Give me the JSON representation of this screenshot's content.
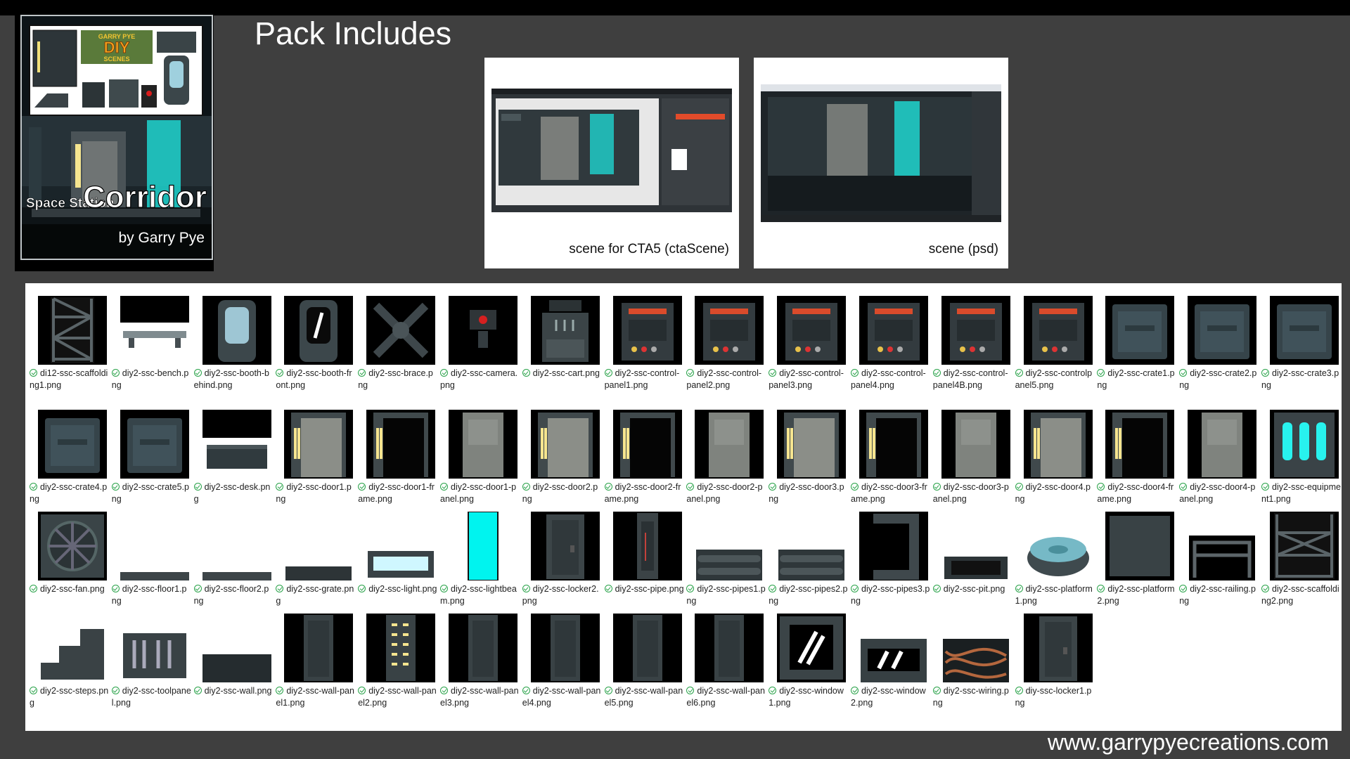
{
  "title": "Pack Includes",
  "cover": {
    "logo_top": "GARRY PYE",
    "logo_main": "DIY",
    "logo_sub": "SCENES",
    "subtitle": "Space Station",
    "name": "Corridor",
    "author": "by Garry Pye"
  },
  "screenshots": [
    {
      "caption": "scene for CTA5 (ctaScene)"
    },
    {
      "caption": "scene (psd)"
    }
  ],
  "colors": {
    "accent": "#1fd5cf",
    "background": "#3f3f3f",
    "check": "#2aa34a"
  },
  "files": [
    {
      "name": "di12-ssc-scaffolding1.png",
      "icon": "scaffold-icon"
    },
    {
      "name": "diy2-ssc-bench.png",
      "icon": "bench-icon"
    },
    {
      "name": "diy2-ssc-booth-behind.png",
      "icon": "booth-icon"
    },
    {
      "name": "diy2-ssc-booth-front.png",
      "icon": "booth-front-icon"
    },
    {
      "name": "diy2-ssc-brace.png",
      "icon": "brace-icon"
    },
    {
      "name": "diy2-ssc-camera.png",
      "icon": "camera-icon"
    },
    {
      "name": "diy2-ssc-cart.png",
      "icon": "cart-icon"
    },
    {
      "name": "diy2-ssc-control-panel1.png",
      "icon": "control-panel-icon"
    },
    {
      "name": "diy2-ssc-control-panel2.png",
      "icon": "control-panel-icon"
    },
    {
      "name": "diy2-ssc-control-panel3.png",
      "icon": "control-panel-icon"
    },
    {
      "name": "diy2-ssc-control-panel4.png",
      "icon": "control-panel-icon"
    },
    {
      "name": "diy2-ssc-control-panel4B.png",
      "icon": "control-panel-icon"
    },
    {
      "name": "diy2-ssc-controlpanel5.png",
      "icon": "control-panel-icon"
    },
    {
      "name": "diy2-ssc-crate1.png",
      "icon": "crate-icon"
    },
    {
      "name": "diy2-ssc-crate2.png",
      "icon": "crate-icon"
    },
    {
      "name": "diy2-ssc-crate3.png",
      "icon": "crate-icon"
    },
    {
      "name": "diy2-ssc-crate4.png",
      "icon": "crate-icon"
    },
    {
      "name": "diy2-ssc-crate5.png",
      "icon": "crate-icon"
    },
    {
      "name": "diy2-ssc-desk.png",
      "icon": "desk-icon"
    },
    {
      "name": "diy2-ssc-door1.png",
      "icon": "door-icon"
    },
    {
      "name": "diy2-ssc-door1-frame.png",
      "icon": "door-frame-icon"
    },
    {
      "name": "diy2-ssc-door1-panel.png",
      "icon": "door-panel-icon"
    },
    {
      "name": "diy2-ssc-door2.png",
      "icon": "door-icon"
    },
    {
      "name": "diy2-ssc-door2-frame.png",
      "icon": "door-frame-icon"
    },
    {
      "name": "diy2-ssc-door2-panel.png",
      "icon": "door-panel-icon"
    },
    {
      "name": "diy2-ssc-door3.png",
      "icon": "door-icon"
    },
    {
      "name": "diy2-ssc-door3-frame.png",
      "icon": "door-frame-icon"
    },
    {
      "name": "diy2-ssc-door3-panel.png",
      "icon": "door-panel-icon"
    },
    {
      "name": "diy2-ssc-door4.png",
      "icon": "door-icon"
    },
    {
      "name": "diy2-ssc-door4-frame.png",
      "icon": "door-frame-icon"
    },
    {
      "name": "diy2-ssc-door4-panel.png",
      "icon": "door-panel-icon"
    },
    {
      "name": "diy2-ssc-equipment1.png",
      "icon": "equipment-icon"
    },
    {
      "name": "diy2-ssc-fan.png",
      "icon": "fan-icon"
    },
    {
      "name": "diy2-ssc-floor1.png",
      "icon": "floor-icon"
    },
    {
      "name": "diy2-ssc-floor2.png",
      "icon": "floor-icon"
    },
    {
      "name": "diy2-ssc-grate.png",
      "icon": "grate-icon"
    },
    {
      "name": "diy2-ssc-light.png",
      "icon": "light-icon"
    },
    {
      "name": "diy2-ssc-lightbeam.png",
      "icon": "lightbeam-icon"
    },
    {
      "name": "diy2-ssc-locker2.png",
      "icon": "locker-icon"
    },
    {
      "name": "diy2-ssc-pipe.png",
      "icon": "pipe-icon"
    },
    {
      "name": "diy2-ssc-pipes1.png",
      "icon": "pipes-icon"
    },
    {
      "name": "diy2-ssc-pipes2.png",
      "icon": "pipes-icon"
    },
    {
      "name": "diy2-ssc-pipes3.png",
      "icon": "pipes-frame-icon"
    },
    {
      "name": "diy2-ssc-pit.png",
      "icon": "pit-icon"
    },
    {
      "name": "diy2-ssc-platform1.png",
      "icon": "platform-icon"
    },
    {
      "name": "diy2-ssc-platform2.png",
      "icon": "platform2-icon"
    },
    {
      "name": "diy2-ssc-railing.png",
      "icon": "railing-icon"
    },
    {
      "name": "diy2-ssc-scaffolding2.png",
      "icon": "scaffold2-icon"
    },
    {
      "name": "diy2-ssc-steps.png",
      "icon": "steps-icon"
    },
    {
      "name": "diy2-ssc-toolpanel.png",
      "icon": "toolpanel-icon"
    },
    {
      "name": "diy2-ssc-wall.png",
      "icon": "wall-icon"
    },
    {
      "name": "diy2-ssc-wall-panel1.png",
      "icon": "wall-panel-icon"
    },
    {
      "name": "diy2-ssc-wall-panel2.png",
      "icon": "wall-panel-lights-icon"
    },
    {
      "name": "diy2-ssc-wall-panel3.png",
      "icon": "wall-panel-icon"
    },
    {
      "name": "diy2-ssc-wall-panel4.png",
      "icon": "wall-panel-icon"
    },
    {
      "name": "diy2-ssc-wall-panel5.png",
      "icon": "wall-panel-icon"
    },
    {
      "name": "diy2-ssc-wall-panel6.png",
      "icon": "wall-panel-icon"
    },
    {
      "name": "diy2-ssc-window1.png",
      "icon": "window-icon"
    },
    {
      "name": "diy2-ssc-window2.png",
      "icon": "window-wide-icon"
    },
    {
      "name": "diy2-ssc-wiring.png",
      "icon": "wiring-icon"
    },
    {
      "name": "diy-ssc-locker1.png",
      "icon": "locker-icon"
    }
  ],
  "website": "www.garrypyecreations.com"
}
